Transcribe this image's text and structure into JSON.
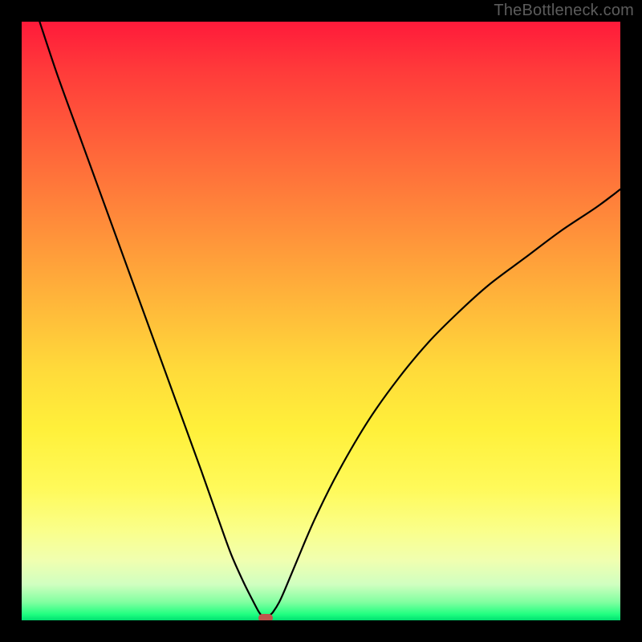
{
  "watermark": "TheBottleneck.com",
  "chart_data": {
    "type": "line",
    "title": "",
    "xlabel": "",
    "ylabel": "",
    "xlim": [
      0,
      100
    ],
    "ylim": [
      0,
      100
    ],
    "grid": false,
    "series": [
      {
        "name": "bottleneck-curve",
        "x": [
          3,
          6,
          10,
          14,
          18,
          22,
          26,
          30,
          33,
          35,
          37,
          38.5,
          39.5,
          40,
          40.5,
          41,
          41.5,
          42,
          43,
          44,
          46,
          49,
          53,
          58,
          63,
          68,
          73,
          78,
          84,
          90,
          96,
          100
        ],
        "y": [
          100,
          91,
          80,
          69,
          58,
          47,
          36,
          25,
          16.5,
          11,
          6.5,
          3.5,
          1.6,
          0.9,
          0.6,
          0.6,
          0.9,
          1.4,
          3,
          5.2,
          10,
          17,
          25,
          33.5,
          40.5,
          46.5,
          51.5,
          56,
          60.5,
          65,
          69,
          72
        ]
      }
    ],
    "marker": {
      "x": 40.8,
      "y": 0.4
    },
    "background_gradient": {
      "top": "#ff1a3a",
      "mid": "#ffda3a",
      "bottom": "#00e070"
    },
    "colors": {
      "curve": "#000000",
      "marker": "#c0544c",
      "frame": "#000000"
    }
  }
}
